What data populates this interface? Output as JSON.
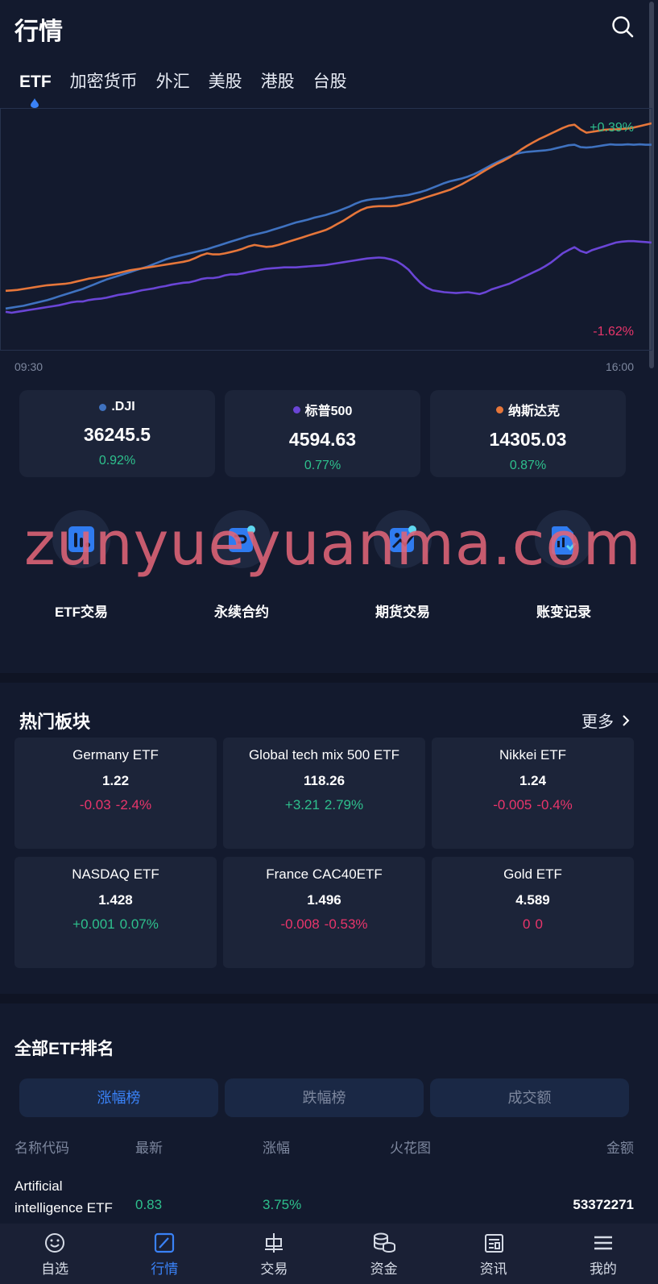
{
  "header": {
    "title": "行情"
  },
  "tabs": [
    {
      "label": "ETF"
    },
    {
      "label": "加密货币"
    },
    {
      "label": "外汇"
    },
    {
      "label": "美股"
    },
    {
      "label": "港股"
    },
    {
      "label": "台股"
    }
  ],
  "chart_data": {
    "type": "line",
    "x_range": [
      "09:30",
      "16:00"
    ],
    "top_label": "+0.39%",
    "bottom_label": "-1.62%",
    "grid": false,
    "series": [
      {
        "name": ".DJI",
        "color": "#3f72c0",
        "values": [
          0.0,
          0.02,
          0.04,
          0.06,
          0.09,
          0.12,
          0.15,
          0.18,
          0.22,
          0.26,
          0.3,
          0.34,
          0.38,
          0.42,
          0.47,
          0.52,
          0.57,
          0.62,
          0.66,
          0.7,
          0.74,
          0.78,
          0.82,
          0.86,
          0.9,
          0.95,
          1.0,
          1.05,
          1.09,
          1.12,
          1.15,
          1.18,
          1.21,
          1.24,
          1.27,
          1.31,
          1.35,
          1.39,
          1.43,
          1.47,
          1.51,
          1.55,
          1.58,
          1.61,
          1.64,
          1.68,
          1.72,
          1.76,
          1.8,
          1.84,
          1.87,
          1.9,
          1.94,
          1.97,
          2.0,
          2.04,
          2.08,
          2.13,
          2.18,
          2.24,
          2.29,
          2.32,
          2.34,
          2.35,
          2.36,
          2.38,
          2.4,
          2.41,
          2.43,
          2.46,
          2.49,
          2.53,
          2.58,
          2.63,
          2.68,
          2.72,
          2.75,
          2.78,
          2.82,
          2.87,
          2.93,
          3.0,
          3.07,
          3.13,
          3.19,
          3.25,
          3.3,
          3.33,
          3.35,
          3.36,
          3.37,
          3.38,
          3.4,
          3.43,
          3.46,
          3.49,
          3.5,
          3.45,
          3.44,
          3.45,
          3.47,
          3.49,
          3.51,
          3.5,
          3.5,
          3.51,
          3.5,
          3.51,
          3.5,
          3.5
        ]
      },
      {
        "name": "标普500",
        "color": "#6a45d6",
        "values": [
          0.0,
          -0.02,
          0.0,
          0.02,
          0.04,
          0.06,
          0.08,
          0.1,
          0.12,
          0.14,
          0.17,
          0.2,
          0.22,
          0.22,
          0.25,
          0.27,
          0.28,
          0.3,
          0.33,
          0.36,
          0.38,
          0.4,
          0.43,
          0.46,
          0.48,
          0.5,
          0.53,
          0.55,
          0.58,
          0.6,
          0.62,
          0.63,
          0.66,
          0.7,
          0.72,
          0.72,
          0.74,
          0.78,
          0.8,
          0.8,
          0.82,
          0.85,
          0.87,
          0.9,
          0.92,
          0.93,
          0.94,
          0.95,
          0.95,
          0.95,
          0.96,
          0.97,
          0.98,
          0.99,
          1.0,
          1.02,
          1.04,
          1.06,
          1.08,
          1.1,
          1.12,
          1.14,
          1.15,
          1.16,
          1.15,
          1.12,
          1.08,
          1.0,
          0.9,
          0.75,
          0.62,
          0.52,
          0.46,
          0.44,
          0.42,
          0.41,
          0.4,
          0.41,
          0.42,
          0.4,
          0.38,
          0.42,
          0.48,
          0.52,
          0.56,
          0.6,
          0.66,
          0.72,
          0.78,
          0.84,
          0.9,
          0.97,
          1.05,
          1.15,
          1.25,
          1.32,
          1.38,
          1.3,
          1.26,
          1.32,
          1.36,
          1.4,
          1.44,
          1.48,
          1.5,
          1.51,
          1.51,
          1.5,
          1.49,
          1.48
        ]
      },
      {
        "name": "纳斯达克",
        "color": "#e6763a",
        "values": [
          0.0,
          0.01,
          0.02,
          0.04,
          0.06,
          0.08,
          0.1,
          0.12,
          0.13,
          0.14,
          0.15,
          0.17,
          0.2,
          0.23,
          0.26,
          0.28,
          0.3,
          0.32,
          0.35,
          0.38,
          0.41,
          0.44,
          0.46,
          0.48,
          0.5,
          0.52,
          0.54,
          0.56,
          0.58,
          0.6,
          0.62,
          0.65,
          0.7,
          0.76,
          0.8,
          0.78,
          0.78,
          0.8,
          0.83,
          0.86,
          0.9,
          0.95,
          0.98,
          0.96,
          0.94,
          0.95,
          0.98,
          1.02,
          1.06,
          1.1,
          1.14,
          1.18,
          1.22,
          1.26,
          1.3,
          1.36,
          1.43,
          1.5,
          1.58,
          1.66,
          1.73,
          1.78,
          1.8,
          1.81,
          1.81,
          1.81,
          1.82,
          1.85,
          1.88,
          1.92,
          1.96,
          2.0,
          2.04,
          2.08,
          2.12,
          2.16,
          2.22,
          2.28,
          2.35,
          2.42,
          2.5,
          2.58,
          2.65,
          2.72,
          2.78,
          2.85,
          2.93,
          3.02,
          3.1,
          3.17,
          3.24,
          3.3,
          3.36,
          3.42,
          3.48,
          3.53,
          3.55,
          3.45,
          3.38,
          3.4,
          3.42,
          3.44,
          3.45,
          3.45,
          3.46,
          3.47,
          3.49,
          3.52,
          3.55,
          3.58
        ]
      }
    ]
  },
  "indices": [
    {
      "name": ".DJI",
      "value": "36245.5",
      "change": "0.92%",
      "dot_color": "#3f72c0"
    },
    {
      "name": "标普500",
      "value": "4594.63",
      "change": "0.77%",
      "dot_color": "#6a45d6"
    },
    {
      "name": "纳斯达克",
      "value": "14305.03",
      "change": "0.87%",
      "dot_color": "#e6763a"
    }
  ],
  "shortcuts": [
    {
      "label": "ETF交易",
      "icon": "etf-trade-icon"
    },
    {
      "label": "永续合约",
      "icon": "perpetual-contract-icon"
    },
    {
      "label": "期货交易",
      "icon": "futures-trade-icon"
    },
    {
      "label": "账变记录",
      "icon": "account-record-icon"
    }
  ],
  "watermark": "zunyueyuanma.com",
  "hot": {
    "title": "热门板块",
    "more": "更多",
    "sectors": [
      {
        "name": "Germany ETF",
        "price": "1.22",
        "change": "-0.03",
        "pct": "-2.4%",
        "dir": "down"
      },
      {
        "name": "Global tech mix 500 ETF",
        "price": "118.26",
        "change": "+3.21",
        "pct": "2.79%",
        "dir": "up"
      },
      {
        "name": "Nikkei ETF",
        "price": "1.24",
        "change": "-0.005",
        "pct": "-0.4%",
        "dir": "down"
      },
      {
        "name": "NASDAQ ETF",
        "price": "1.428",
        "change": "+0.001",
        "pct": "0.07%",
        "dir": "up"
      },
      {
        "name": "France CAC40ETF",
        "price": "1.496",
        "change": "-0.008",
        "pct": "-0.53%",
        "dir": "down"
      },
      {
        "name": "Gold ETF",
        "price": "4.589",
        "change": "0",
        "pct": "0",
        "dir": "down"
      }
    ]
  },
  "ranking": {
    "title": "全部ETF排名",
    "tabs": [
      "涨幅榜",
      "跌幅榜",
      "成交额"
    ],
    "columns": [
      "名称代码",
      "最新",
      "涨幅",
      "火花图",
      "金额"
    ],
    "rows": [
      {
        "name": "Artificial intelligence ETF",
        "price": "0.83",
        "change": "3.75%",
        "amount": "53372271"
      }
    ]
  },
  "colors": {
    "up": "#2ec08d",
    "down": "#e9356b",
    "accent": "#3a82f7",
    "background": "#131a2e"
  },
  "nav": [
    {
      "label": "自选",
      "icon": "smiley-icon"
    },
    {
      "label": "行情",
      "icon": "chart-icon"
    },
    {
      "label": "交易",
      "icon": "trade-icon"
    },
    {
      "label": "资金",
      "icon": "coins-icon"
    },
    {
      "label": "资讯",
      "icon": "news-icon"
    },
    {
      "label": "我的",
      "icon": "menu-icon"
    }
  ]
}
